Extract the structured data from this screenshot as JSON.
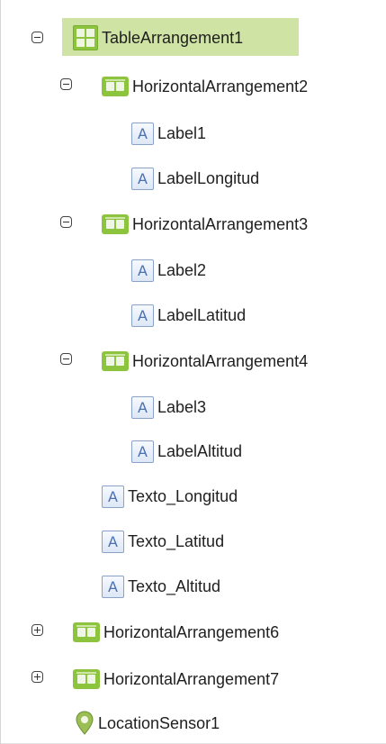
{
  "tree": {
    "root": {
      "label": "TableArrangement1",
      "icon": "table-arrangement-icon",
      "expanded": true,
      "selected": true
    },
    "h2": {
      "label": "HorizontalArrangement2",
      "icon": "horizontal-arrangement-icon",
      "expanded": true
    },
    "label1": {
      "label": "Label1",
      "icon": "label-icon"
    },
    "label_longitud": {
      "label": "LabelLongitud",
      "icon": "label-icon"
    },
    "h3": {
      "label": "HorizontalArrangement3",
      "icon": "horizontal-arrangement-icon",
      "expanded": true
    },
    "label2": {
      "label": "Label2",
      "icon": "label-icon"
    },
    "label_latitud": {
      "label": "LabelLatitud",
      "icon": "label-icon"
    },
    "h4": {
      "label": "HorizontalArrangement4",
      "icon": "horizontal-arrangement-icon",
      "expanded": true
    },
    "label3": {
      "label": "Label3",
      "icon": "label-icon"
    },
    "label_altitud": {
      "label": "LabelAltitud",
      "icon": "label-icon"
    },
    "texto_longitud": {
      "label": "Texto_Longitud",
      "icon": "label-icon"
    },
    "texto_latitud": {
      "label": "Texto_Latitud",
      "icon": "label-icon"
    },
    "texto_altitud": {
      "label": "Texto_Altitud",
      "icon": "label-icon"
    },
    "h6": {
      "label": "HorizontalArrangement6",
      "icon": "horizontal-arrangement-icon",
      "expanded": false
    },
    "h7": {
      "label": "HorizontalArrangement7",
      "icon": "horizontal-arrangement-icon",
      "expanded": false
    },
    "location": {
      "label": "LocationSensor1",
      "icon": "location-sensor-icon"
    }
  },
  "label_icon_glyph": "A",
  "colors": {
    "selected_bg": "#cfe3a4",
    "arrangement_green": "#8cc43e",
    "label_blue": "#4a6fb4"
  }
}
